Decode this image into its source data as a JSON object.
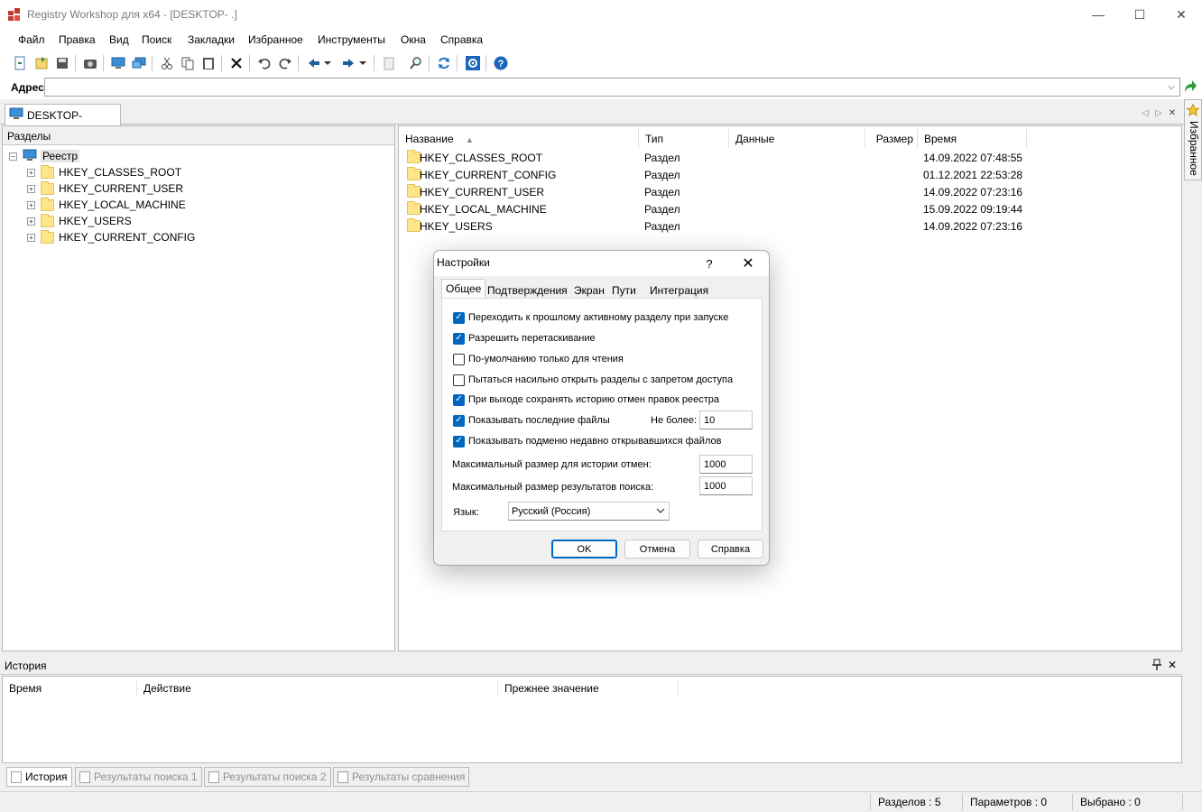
{
  "window": {
    "title": "Registry Workshop для x64 - [DESKTOP-               .]",
    "minimize_glyph": "—",
    "maximize_glyph": "☐",
    "close_glyph": "✕"
  },
  "menu": [
    "Файл",
    "Правка",
    "Вид",
    "Поиск",
    "Закладки",
    "Избранное",
    "Инструменты",
    "Окна",
    "Справка"
  ],
  "address": {
    "label": "Адрес",
    "value": "",
    "dropdown_glyph": "⌵"
  },
  "doc_tab": {
    "label": "DESKTOP-"
  },
  "nav": {
    "prev": "◁",
    "next": "▷",
    "close": "✕"
  },
  "favorites": {
    "label": "Избранное"
  },
  "left_panel": {
    "header": "Разделы",
    "root": "Реестр",
    "keys": [
      "HKEY_CLASSES_ROOT",
      "HKEY_CURRENT_USER",
      "HKEY_LOCAL_MACHINE",
      "HKEY_USERS",
      "HKEY_CURRENT_CONFIG"
    ],
    "expander_glyph": "+",
    "collapse_glyph": "−"
  },
  "right_panel": {
    "columns": [
      "Название",
      "Тип",
      "Данные",
      "Размер",
      "Время"
    ],
    "sort_glyph": "▲",
    "rows": [
      {
        "name": "HKEY_CLASSES_ROOT",
        "type": "Раздел",
        "data": "",
        "size": "",
        "time": "14.09.2022 07:48:55"
      },
      {
        "name": "HKEY_CURRENT_CONFIG",
        "type": "Раздел",
        "data": "",
        "size": "",
        "time": "01.12.2021 22:53:28"
      },
      {
        "name": "HKEY_CURRENT_USER",
        "type": "Раздел",
        "data": "",
        "size": "",
        "time": "14.09.2022 07:23:16"
      },
      {
        "name": "HKEY_LOCAL_MACHINE",
        "type": "Раздел",
        "data": "",
        "size": "",
        "time": "15.09.2022 09:19:44"
      },
      {
        "name": "HKEY_USERS",
        "type": "Раздел",
        "data": "",
        "size": "",
        "time": "14.09.2022 07:23:16"
      }
    ]
  },
  "history": {
    "header": "История",
    "pin_glyph": "📌",
    "close_glyph": "✕",
    "columns": [
      "Время",
      "Действие",
      "Прежнее значение"
    ]
  },
  "bottom_tabs": [
    "История",
    "Результаты поиска 1",
    "Результаты поиска 2",
    "Результаты сравнения"
  ],
  "status": {
    "sections": "Разделов : 5",
    "params": "Параметров : 0",
    "selected": "Выбрано : 0"
  },
  "dialog": {
    "title": "Настройки",
    "help_glyph": "?",
    "close_glyph": "✕",
    "tabs": [
      "Общее",
      "Подтверждения",
      "Экран",
      "Пути",
      "Интеграция"
    ],
    "check_glyph": "✓",
    "options": [
      {
        "label": "Переходить к прошлому активному разделу при запуске",
        "checked": true
      },
      {
        "label": "Разрешить перетаскивание",
        "checked": true
      },
      {
        "label": "По-умолчанию только для чтения",
        "checked": false
      },
      {
        "label": "Пытаться насильно открыть разделы с запретом доступа",
        "checked": false
      },
      {
        "label": "При выходе сохранять историю отмен правок реестра",
        "checked": true
      },
      {
        "label": "Показывать последние файлы",
        "checked": true
      },
      {
        "label": "Показывать подменю недавно открывавшихся файлов",
        "checked": true
      }
    ],
    "recent_limit_label": "Не более:",
    "recent_limit_value": "10",
    "undo_history_label": "Максимальный размер для истории отмен:",
    "undo_history_value": "1000",
    "search_results_label": "Максимальный размер результатов поиска:",
    "search_results_value": "1000",
    "language_label": "Язык:",
    "language_value": "Русский (Россия)",
    "buttons": {
      "ok": "OK",
      "cancel": "Отмена",
      "help": "Справка"
    }
  }
}
